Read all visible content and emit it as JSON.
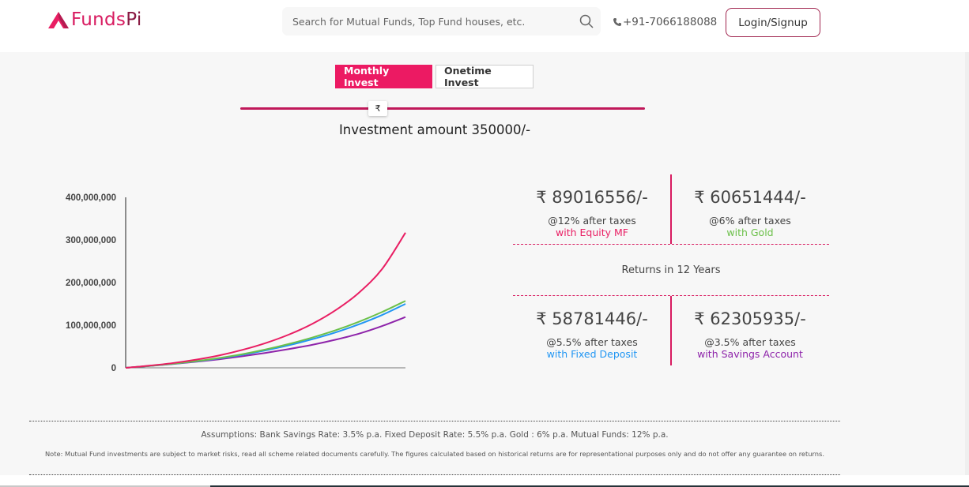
{
  "header": {
    "logo": {
      "part1": "Funds",
      "part2": "Pi"
    },
    "search": {
      "placeholder": "Search for Mutual Funds, Top Fund houses, etc.",
      "value": ""
    },
    "phone": "+91-7066188088",
    "login_label": "Login/Signup"
  },
  "tabs": [
    {
      "label": "Monthly Invest",
      "active": true
    },
    {
      "label": "Onetime Invest",
      "active": false
    }
  ],
  "slider": {
    "thumb_symbol": "₹",
    "fraction": 0.34
  },
  "investment_amount": "Investment amount 350000/-",
  "returns": {
    "title": "Returns in 12 Years",
    "items": [
      {
        "amount": "₹ 89016556/-",
        "rate": "@12% after taxes",
        "name": "with Equity MF",
        "color": "#e91e63"
      },
      {
        "amount": "₹ 60651444/-",
        "rate": "@6% after taxes",
        "name": "with Gold",
        "color": "#6cc04a"
      },
      {
        "amount": "₹ 58781446/-",
        "rate": "@5.5% after taxes",
        "name": "with Fixed Deposit",
        "color": "#2196f3"
      },
      {
        "amount": "₹ 62305935/-",
        "rate": "@3.5% after taxes",
        "name": "with Savings Account",
        "color": "#8e24aa"
      }
    ]
  },
  "footer": {
    "assumptions": "Assumptions: Bank Savings Rate: 3.5% p.a. Fixed Deposit Rate: 5.5% p.a. Gold : 6% p.a. Mutual Funds: 12% p.a.",
    "note": "Note: Mutual Fund investments are subject to market risks, read all scheme related documents carefully. The figures calculated based on historical returns are for representational purposes only and do not offer any guarantee on returns."
  },
  "chart_data": {
    "type": "line",
    "title": "",
    "xlabel": "",
    "ylabel": "",
    "x": [
      0,
      1,
      2,
      3,
      4,
      5,
      6,
      7,
      8,
      9,
      10,
      11,
      12
    ],
    "ylim": [
      0,
      400000000
    ],
    "yticks": [
      "0",
      "100,000,000",
      "200,000,000",
      "300,000,000",
      "400,000,000"
    ],
    "ytick_values": [
      0,
      100000000,
      200000000,
      300000000,
      400000000
    ],
    "grid": false,
    "legend": "none",
    "series": [
      {
        "name": "Equity MF",
        "color": "#e91e63",
        "values": [
          0,
          5000000,
          11000000,
          19000000,
          29000000,
          42000000,
          58000000,
          78000000,
          103000000,
          135000000,
          176000000,
          232000000,
          317000000
        ]
      },
      {
        "name": "Gold",
        "color": "#6cc04a",
        "values": [
          0,
          4500000,
          9500000,
          15500000,
          23000000,
          32000000,
          43000000,
          56000000,
          71000000,
          88000000,
          108000000,
          131000000,
          157000000
        ]
      },
      {
        "name": "Fixed Deposit",
        "color": "#2196f3",
        "values": [
          0,
          4400000,
          9300000,
          15000000,
          22000000,
          30500000,
          41000000,
          53000000,
          67000000,
          83000000,
          102000000,
          124000000,
          150000000
        ]
      },
      {
        "name": "Savings Account",
        "color": "#8e24aa",
        "values": [
          0,
          4200000,
          8800000,
          14000000,
          20000000,
          27000000,
          35000000,
          44000000,
          54000000,
          66000000,
          80000000,
          98000000,
          119000000
        ]
      }
    ]
  }
}
